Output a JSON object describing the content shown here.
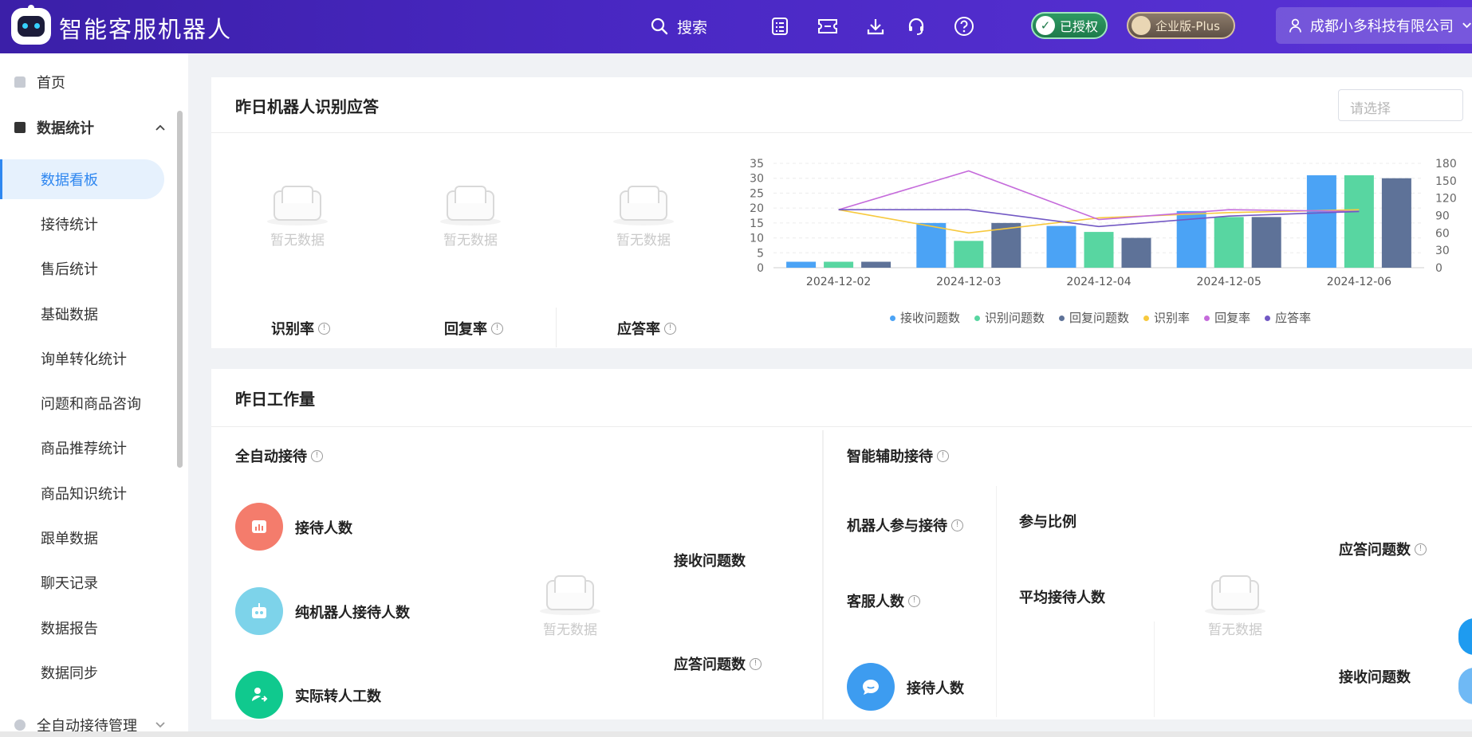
{
  "app": {
    "title": "智能客服机器人"
  },
  "topbar": {
    "search_label": "搜索",
    "icons": [
      "checklist-icon",
      "ticket-icon",
      "download-icon",
      "headset-icon",
      "help-icon"
    ],
    "auth_badge": "已授权",
    "plan_badge": "企业版-Plus",
    "company": "成都小多科技有限公司"
  },
  "sidebar": {
    "home": "首页",
    "data_stats": "数据统计",
    "items": [
      "数据看板",
      "接待统计",
      "售后统计",
      "基础数据",
      "询单转化统计",
      "问题和商品咨询",
      "商品推荐统计",
      "商品知识统计",
      "跟单数据",
      "聊天记录",
      "数据报告",
      "数据同步"
    ],
    "auto_reception": "全自动接待管理"
  },
  "recognition_card": {
    "title": "昨日机器人识别应答",
    "select_placeholder": "请选择",
    "empty_text": "暂无数据",
    "metrics": [
      "识别率",
      "回复率",
      "应答率"
    ]
  },
  "workload_card": {
    "title": "昨日工作量",
    "auto": {
      "title": "全自动接待",
      "rows": [
        "接待人数",
        "纯机器人接待人数",
        "实际转人工数"
      ],
      "received": "接收问题数",
      "answered": "应答问题数",
      "empty_text": "暂无数据"
    },
    "assist": {
      "title": "智能辅助接待",
      "robot_participation": "机器人参与接待",
      "participation_ratio": "参与比例",
      "agents": "客服人数",
      "avg_reception": "平均接待人数",
      "reception": "接待人数",
      "answered": "应答问题数",
      "received": "接收问题数",
      "empty_text": "暂无数据"
    }
  },
  "colors": {
    "accent": "#2f87f0",
    "header": "#4a28c4",
    "received": "#4ba3f5",
    "recognized": "#58d6a1",
    "replied_q": "#5e7298",
    "recog_rate": "#f7c93e",
    "reply_rate": "#c56bdb",
    "answer_rate": "#7258c4"
  },
  "chart_data": {
    "type": "bar",
    "categories": [
      "2024-12-02",
      "2024-12-03",
      "2024-12-04",
      "2024-12-05",
      "2024-12-06"
    ],
    "ylim": [
      0,
      35
    ],
    "y_ticks": [
      0,
      5,
      10,
      15,
      20,
      25,
      30,
      35
    ],
    "y2lim": [
      0,
      180
    ],
    "y2_ticks": [
      0,
      30,
      60,
      90,
      120,
      150,
      180
    ],
    "series": [
      {
        "name": "接收问题数",
        "kind": "bar",
        "axis": "left",
        "color": "#4ba3f5",
        "values": [
          2,
          15,
          14,
          19,
          31
        ]
      },
      {
        "name": "识别问题数",
        "kind": "bar",
        "axis": "left",
        "color": "#58d6a1",
        "values": [
          2,
          9,
          12,
          17,
          31
        ]
      },
      {
        "name": "回复问题数",
        "kind": "bar",
        "axis": "left",
        "color": "#5e7298",
        "values": [
          2,
          15,
          10,
          17,
          30
        ]
      },
      {
        "name": "识别率",
        "kind": "line",
        "axis": "right",
        "color": "#f7c93e",
        "values": [
          100,
          60,
          86,
          95,
          100
        ]
      },
      {
        "name": "回复率",
        "kind": "line",
        "axis": "right",
        "color": "#c56bdb",
        "values": [
          100,
          167,
          83,
          100,
          97
        ]
      },
      {
        "name": "应答率",
        "kind": "line",
        "axis": "right",
        "color": "#7258c4",
        "values": [
          100,
          100,
          71,
          89,
          97
        ]
      }
    ],
    "legend": "bottom"
  }
}
